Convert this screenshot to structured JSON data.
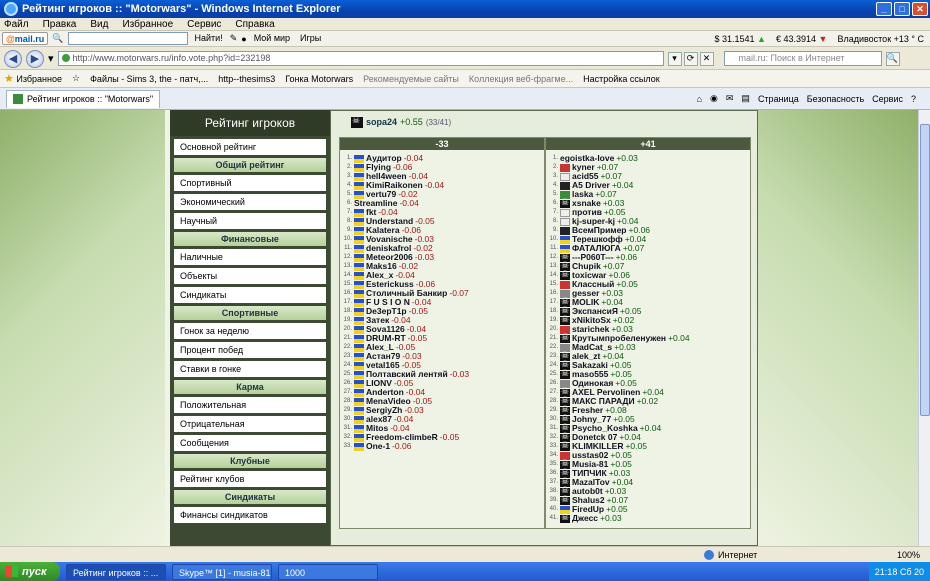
{
  "window": {
    "title": "Рейтинг игроков :: \"Motorwars\" - Windows Internet Explorer"
  },
  "menu": [
    "Файл",
    "Правка",
    "Вид",
    "Избранное",
    "Сервис",
    "Справка"
  ],
  "mailbar": {
    "logo": "mail.ru",
    "find_label": "Найти!",
    "my_world": "Мой мир",
    "games": "Игры",
    "usd": "$ 31.1541",
    "eur": "€ 43.3914",
    "weather": "Владивосток +13 ° C"
  },
  "address": {
    "url": "http://www.motorwars.ru/info.vote.php?id=232198",
    "search_placeholder": "mail.ru: Поиск в Интернет"
  },
  "favorites": {
    "label": "Избранное",
    "items": [
      "Файлы - Sims 3, the - патч,...",
      "http--thesims3",
      "Гонка Motorwars",
      "Рекомендуемые сайты",
      "Коллекция веб-фрагме...",
      "Настройка ссылок"
    ]
  },
  "tab": {
    "label": "Рейтинг игроков :: \"Motorwars\""
  },
  "commands": [
    "Страница",
    "Безопасность",
    "Сервис"
  ],
  "sidebar": {
    "header": "Рейтинг игроков",
    "main_item": "Основной рейтинг",
    "groups": [
      {
        "title": "Общий рейтинг",
        "items": [
          "Спортивный",
          "Экономический",
          "Научный"
        ]
      },
      {
        "title": "Финансовые",
        "items": [
          "Наличные",
          "Объекты",
          "Синдикаты"
        ]
      },
      {
        "title": "Спортивные",
        "items": [
          "Гонок за неделю",
          "Процент побед",
          "Ставки в гонке"
        ]
      },
      {
        "title": "Карма",
        "items": [
          "Положительная",
          "Отрицательная",
          "Сообщения"
        ]
      },
      {
        "title": "Клубные",
        "items": [
          "Рейтинг клубов"
        ]
      },
      {
        "title": "Синдикаты",
        "items": [
          "Финансы синдикатов"
        ]
      }
    ]
  },
  "vote": {
    "player": "sopa24",
    "score": "+0.55",
    "count": "(33/41)",
    "neg_header": "-33",
    "pos_header": "+41",
    "negative": [
      [
        "1.",
        "Аудитор",
        "-0.04",
        "flag"
      ],
      [
        "2.",
        "Flying",
        "-0.06",
        "flag"
      ],
      [
        "3.",
        "hell4ween",
        "-0.04",
        "flag"
      ],
      [
        "4.",
        "KimiRaikonen",
        "-0.04",
        "flag"
      ],
      [
        "5.",
        "vertu79",
        "-0.02",
        "flag"
      ],
      [
        "6.",
        "Streamline",
        "-0.04",
        "none"
      ],
      [
        "7.",
        "fkt",
        "-0.04",
        "flag"
      ],
      [
        "8.",
        "Understand",
        "-0.05",
        "flag"
      ],
      [
        "9.",
        "Kalatera",
        "-0.06",
        "flag"
      ],
      [
        "10.",
        "Vovanische",
        "-0.03",
        "flag"
      ],
      [
        "11.",
        "deniskafrol",
        "-0.02",
        "flag"
      ],
      [
        "12.",
        "Meteor2006",
        "-0.03",
        "flag"
      ],
      [
        "13.",
        "Maks16",
        "-0.02",
        "flag"
      ],
      [
        "14.",
        "Alex_x",
        "-0.04",
        "flag"
      ],
      [
        "15.",
        "Esterickuss",
        "-0.06",
        "flag"
      ],
      [
        "16.",
        "Столичный Банкир",
        "-0.07",
        "flag"
      ],
      [
        "17.",
        "F U S I O N",
        "-0.04",
        "flag"
      ],
      [
        "18.",
        "De3epT1p",
        "-0.05",
        "flag"
      ],
      [
        "19.",
        "Затек",
        "-0.04",
        "flag"
      ],
      [
        "20.",
        "Sova1126",
        "-0.04",
        "flag"
      ],
      [
        "21.",
        "DRUM-RT",
        "-0.05",
        "flag"
      ],
      [
        "22.",
        "Alex_L",
        "-0.05",
        "flag"
      ],
      [
        "23.",
        "Астан79",
        "-0.03",
        "flag"
      ],
      [
        "24.",
        "vetal165",
        "-0.05",
        "flag"
      ],
      [
        "25.",
        "Полтавский лентяй",
        "-0.03",
        "flag"
      ],
      [
        "26.",
        "LIONV",
        "-0.05",
        "flag"
      ],
      [
        "27.",
        "Anderton",
        "-0.04",
        "flag"
      ],
      [
        "28.",
        "MenaVideo",
        "-0.05",
        "flag"
      ],
      [
        "29.",
        "SergiyZh",
        "-0.03",
        "flag"
      ],
      [
        "30.",
        "alex87",
        "-0.04",
        "flag"
      ],
      [
        "31.",
        "Mitos",
        "-0.04",
        "flag"
      ],
      [
        "32.",
        "Freedom-climbeR",
        "-0.05",
        "flag"
      ],
      [
        "33.",
        "One-1",
        "-0.06",
        "flag"
      ]
    ],
    "positive": [
      [
        "1.",
        "egoistka-love",
        "+0.03",
        "none"
      ],
      [
        "2.",
        "kyner",
        "+0.07",
        "red"
      ],
      [
        "3.",
        "acid55",
        "+0.07",
        "white"
      ],
      [
        "4.",
        "A5 Driver",
        "+0.04",
        "dark"
      ],
      [
        "5.",
        "laska",
        "+0.07",
        "green"
      ],
      [
        "6.",
        "xsnake",
        "+0.03",
        "pirate"
      ],
      [
        "7.",
        "против",
        "+0.05",
        "white"
      ],
      [
        "8.",
        "kj-super-kj",
        "+0.04",
        "white"
      ],
      [
        "9.",
        "ВсемПример",
        "+0.06",
        "dark"
      ],
      [
        "10.",
        "Терешкофф",
        "+0.04",
        "flag"
      ],
      [
        "11.",
        "ФАТАЛЮГА",
        "+0.07",
        "flag"
      ],
      [
        "12.",
        "---P060T---",
        "+0.06",
        "pirate"
      ],
      [
        "13.",
        "Chupik",
        "+0.07",
        "pirate"
      ],
      [
        "14.",
        "toxicwar",
        "+0.06",
        "pirate"
      ],
      [
        "15.",
        "Классный",
        "+0.05",
        "red"
      ],
      [
        "16.",
        "gesser",
        "+0.03",
        "grey"
      ],
      [
        "17.",
        "MOLIK",
        "+0.04",
        "pirate"
      ],
      [
        "18.",
        "ЭкспансиЯ",
        "+0.05",
        "pirate"
      ],
      [
        "19.",
        "xNikitoSx",
        "+0.02",
        "pirate"
      ],
      [
        "20.",
        "starichek",
        "+0.03",
        "red"
      ],
      [
        "21.",
        "Крутымпробеленужен",
        "+0.04",
        "pirate"
      ],
      [
        "22.",
        "MadCat_s",
        "+0.03",
        "grey"
      ],
      [
        "23.",
        "alek_zt",
        "+0.04",
        "pirate"
      ],
      [
        "24.",
        "Sakazaki",
        "+0.05",
        "pirate"
      ],
      [
        "25.",
        "maso555",
        "+0.05",
        "pirate"
      ],
      [
        "26.",
        "Одинокая",
        "+0.05",
        "grey"
      ],
      [
        "27.",
        "AXEL Pervolinen",
        "+0.04",
        "pirate"
      ],
      [
        "28.",
        "МАКС ПАРАДИ",
        "+0.02",
        "pirate"
      ],
      [
        "29.",
        "Fresher",
        "+0.08",
        "pirate"
      ],
      [
        "30.",
        "Johny_77",
        "+0.05",
        "pirate"
      ],
      [
        "31.",
        "Psycho_Koshka",
        "+0.04",
        "pirate"
      ],
      [
        "32.",
        "Donetck 07",
        "+0.04",
        "pirate"
      ],
      [
        "33.",
        "KLIMKILLER",
        "+0.05",
        "pirate"
      ],
      [
        "34.",
        "usstas02",
        "+0.05",
        "red"
      ],
      [
        "35.",
        "Musia-81",
        "+0.05",
        "pirate"
      ],
      [
        "36.",
        "ТИПЧИК",
        "+0.03",
        "pirate"
      ],
      [
        "37.",
        "MazalTov",
        "+0.04",
        "pirate"
      ],
      [
        "38.",
        "autob0t",
        "+0.03",
        "pirate"
      ],
      [
        "39.",
        "Shalus2",
        "+0.07",
        "pirate"
      ],
      [
        "40.",
        "FiredUp",
        "+0.05",
        "flag"
      ],
      [
        "41.",
        "Джесс",
        "+0.03",
        "pirate"
      ]
    ]
  },
  "statusbar": {
    "zone": "Интернет",
    "zoom": "100%"
  },
  "taskbar": {
    "start": "пуск",
    "tasks": [
      "Рейтинг игроков :: ...",
      "Skype™ [1] - musia-81",
      "1000"
    ],
    "clock": "21:18 Сб 20"
  }
}
